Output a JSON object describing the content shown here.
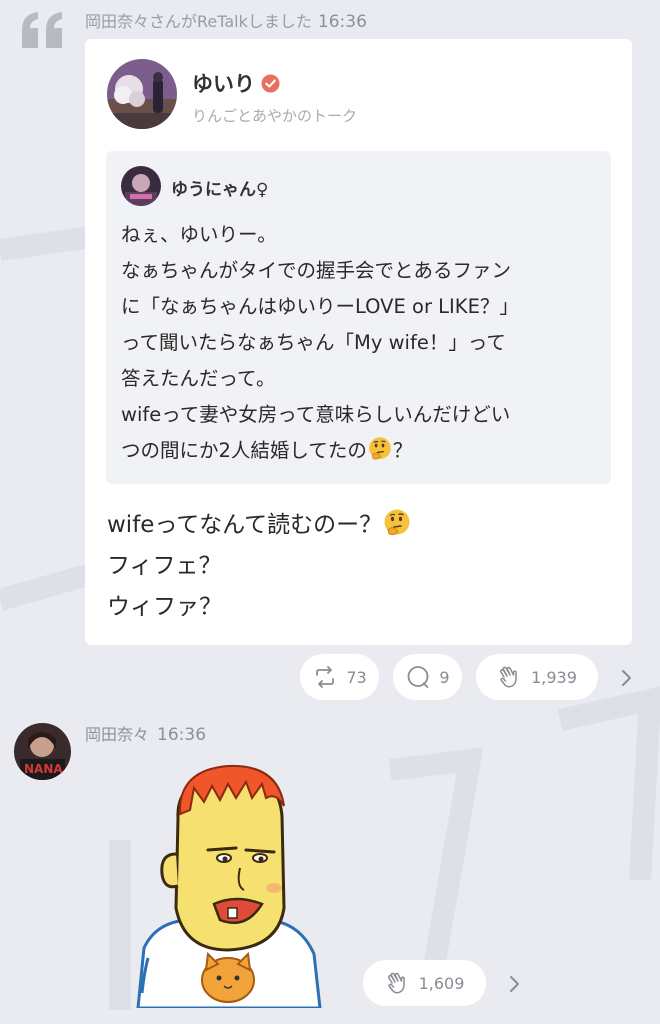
{
  "retalk": {
    "header_text": "岡田奈々さんがReTalkしました",
    "time": "16:36"
  },
  "card": {
    "author": "ゆいり",
    "subtitle": "りんごとあやかのトーク",
    "quoted": {
      "author": "ゆうにゃん♀",
      "lines": [
        "ねぇ、ゆいりー。",
        "なぁちゃんがタイでの握手会でとあるファン",
        "に「なぁちゃんはゆいりーLOVE or LIKE？」",
        "って聞いたらなぁちゃん「My wife！」って",
        "答えたんだって。",
        "wifeって妻や女房って意味らしいんだけどい",
        "つの間にか2人結婚してたの",
        "？"
      ]
    },
    "body_lines": [
      "wifeってなんて読むのー？",
      "フィフェ？",
      "ウィファ？"
    ]
  },
  "reactions": {
    "retalk_count": "73",
    "comment_count": "9",
    "clap_count": "1,939"
  },
  "post": {
    "author": "岡田奈々",
    "time": "16:36",
    "clap_count": "1,609"
  },
  "icons": {
    "quote": "quote-icon",
    "verified": "verified-badge-icon",
    "retalk": "retalk-icon",
    "comment": "comment-icon",
    "clap": "clap-icon",
    "chevron": "chevron-right-icon",
    "thinking": "thinking-face-emoji"
  },
  "colors": {
    "background": "#e9ebf0",
    "card": "#ffffff",
    "quoted_bg": "#f1f2f5",
    "verified": "#e8705f",
    "meta_text": "#8e9098"
  }
}
